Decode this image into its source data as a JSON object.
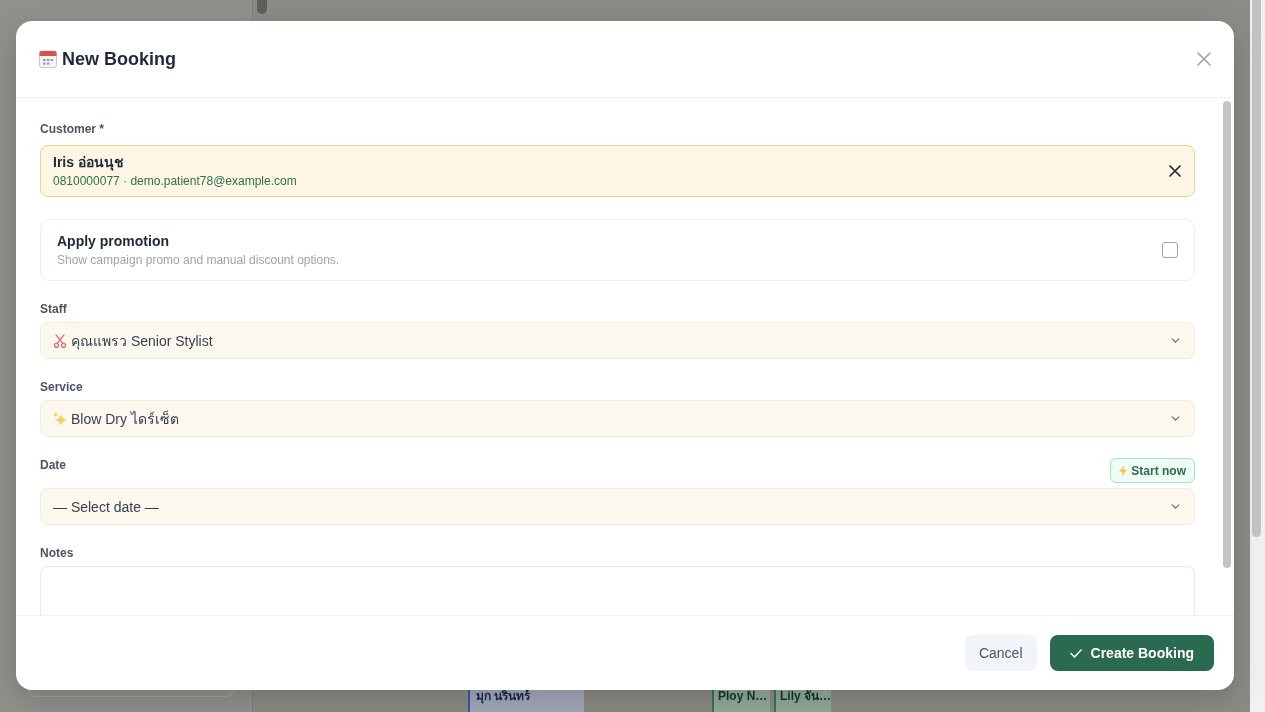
{
  "dialog": {
    "title": "New Booking"
  },
  "customer": {
    "label": "Customer *",
    "name": "Iris อ่อนนุช",
    "details": "0810000077 · demo.patient78@example.com"
  },
  "promotion": {
    "title": "Apply promotion",
    "description": "Show campaign promo and manual discount options.",
    "checked": false
  },
  "staff": {
    "label": "Staff",
    "value": "คุณแพรว Senior Stylist"
  },
  "service": {
    "label": "Service",
    "value": "Blow Dry ไดร์เซ็ต"
  },
  "date": {
    "label": "Date",
    "placeholder": "— Select date —",
    "action": "Start now"
  },
  "notes": {
    "label": "Notes"
  },
  "footer": {
    "buttons": [
      {
        "label": "Cancel",
        "kind": "secondary"
      },
      {
        "label": "Create Booking",
        "kind": "primary"
      }
    ]
  },
  "background": {
    "bookings": [
      {
        "name": "มุก นรินทร์",
        "color": "#3d55a8"
      },
      {
        "name": "Ploy N…",
        "color": "#2f7a4f"
      },
      {
        "name": "Lily จัน…",
        "color": "#2f7a4f"
      }
    ]
  }
}
